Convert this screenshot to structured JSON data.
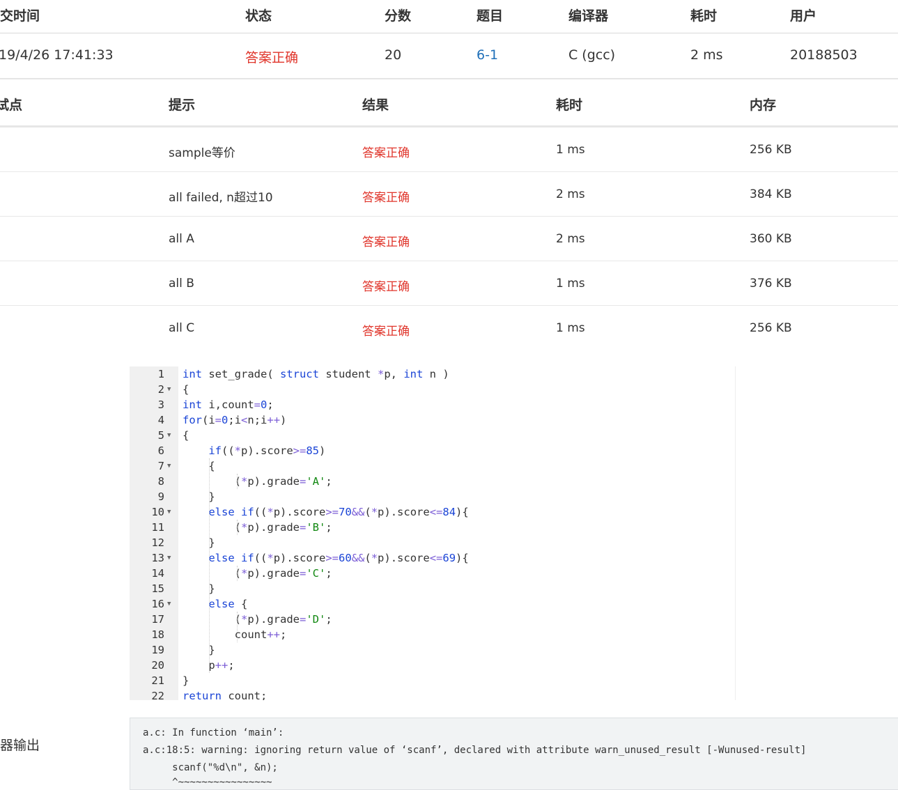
{
  "submission": {
    "headers": [
      "交时间",
      "状态",
      "分数",
      "题目",
      "编译器",
      "耗时",
      "用户"
    ],
    "row": {
      "time": "19/4/26 17:41:33",
      "status": "答案正确",
      "score": "20",
      "problem": "6-1",
      "compiler": "C (gcc)",
      "elapsed": "2 ms",
      "user": "20188503"
    }
  },
  "testcases": {
    "headers": [
      "试点",
      "提示",
      "结果",
      "耗时",
      "内存"
    ],
    "rows": [
      {
        "hint": "sample等价",
        "result": "答案正确",
        "time": "1 ms",
        "memory": "256 KB"
      },
      {
        "hint": "all failed, n超过10",
        "result": "答案正确",
        "time": "2 ms",
        "memory": "384 KB"
      },
      {
        "hint": "all A",
        "result": "答案正确",
        "time": "2 ms",
        "memory": "360 KB"
      },
      {
        "hint": "all B",
        "result": "答案正确",
        "time": "1 ms",
        "memory": "376 KB"
      },
      {
        "hint": "all C",
        "result": "答案正确",
        "time": "1 ms",
        "memory": "256 KB"
      }
    ]
  },
  "code": {
    "lines": [
      "int set_grade( struct student *p, int n )",
      "{",
      "int i,count=0;",
      "for(i=0;i<n;i++)",
      "{",
      "    if((*p).score>=85)",
      "    {",
      "        (*p).grade='A';",
      "    }",
      "    else if((*p).score>=70&&(*p).score<=84){",
      "        (*p).grade='B';",
      "    }",
      "    else if((*p).score>=60&&(*p).score<=69){",
      "        (*p).grade='C';",
      "    }",
      "    else {",
      "        (*p).grade='D';",
      "        count++;",
      "    }",
      "    p++;",
      "}",
      "return count;"
    ],
    "foldable_lines": [
      2,
      5,
      7,
      10,
      13,
      16
    ]
  },
  "compiler_output": {
    "label": "器输出",
    "lines": [
      "a.c: In function ‘main’:",
      "a.c:18:5: warning: ignoring return value of ‘scanf’, declared with attribute warn_unused_result [-Wunused-result]",
      "     scanf(\"%d\\n\", &n);",
      "     ^~~~~~~~~~~~~~~~~"
    ]
  },
  "colors": {
    "accepted": "#e0352b",
    "link": "#1f6fb8",
    "keyword": "#1a44d6",
    "string": "#118811"
  }
}
